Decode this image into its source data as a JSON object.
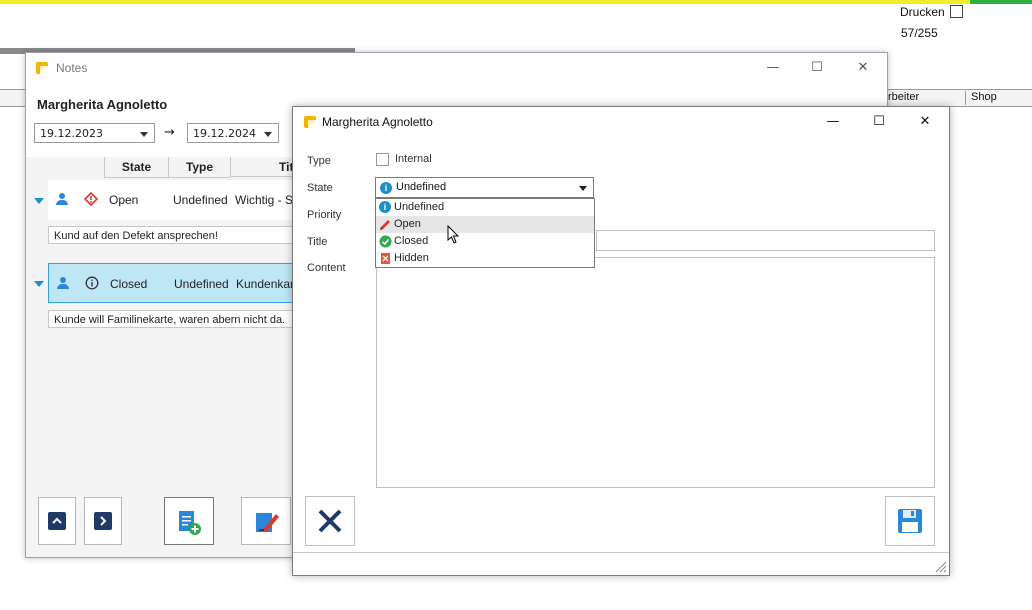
{
  "background_app": {
    "print_label": "Drucken",
    "counter": "57/255",
    "column_worker": "rbeiter",
    "column_shop": "Shop"
  },
  "notes_window": {
    "title": "Notes",
    "customer_name": "Margherita Agnoletto",
    "date_from": "19.12.2023",
    "date_to": "19.12.2024",
    "columns": [
      "State",
      "Type",
      "Titl"
    ],
    "rows": [
      {
        "state": "Open",
        "type": "Undefined",
        "title": "Wichtig - Sc",
        "comment": "Kund auf den Defekt ansprechen!"
      },
      {
        "state": "Closed",
        "type": "Undefined",
        "title": "Kundenkart",
        "comment": "Kunde will Familinekarte, waren abern nicht da."
      }
    ]
  },
  "dialog": {
    "title": "Margherita Agnoletto",
    "type_label": "Type",
    "internal_label": "Internal",
    "state_label": "State",
    "state_value": "Undefined",
    "priority_label": "Priority",
    "title_label": "Title",
    "content_label": "Content",
    "state_options": [
      "Undefined",
      "Open",
      "Closed",
      "Hidden"
    ],
    "hovered_option": "Open"
  },
  "colors": {
    "accent_blue": "#1d8fc8",
    "open_red": "#d93a2b",
    "closed_green": "#2fa84f",
    "selected_row": "#bfe6f5",
    "nav_dark": "#1f3a66"
  }
}
